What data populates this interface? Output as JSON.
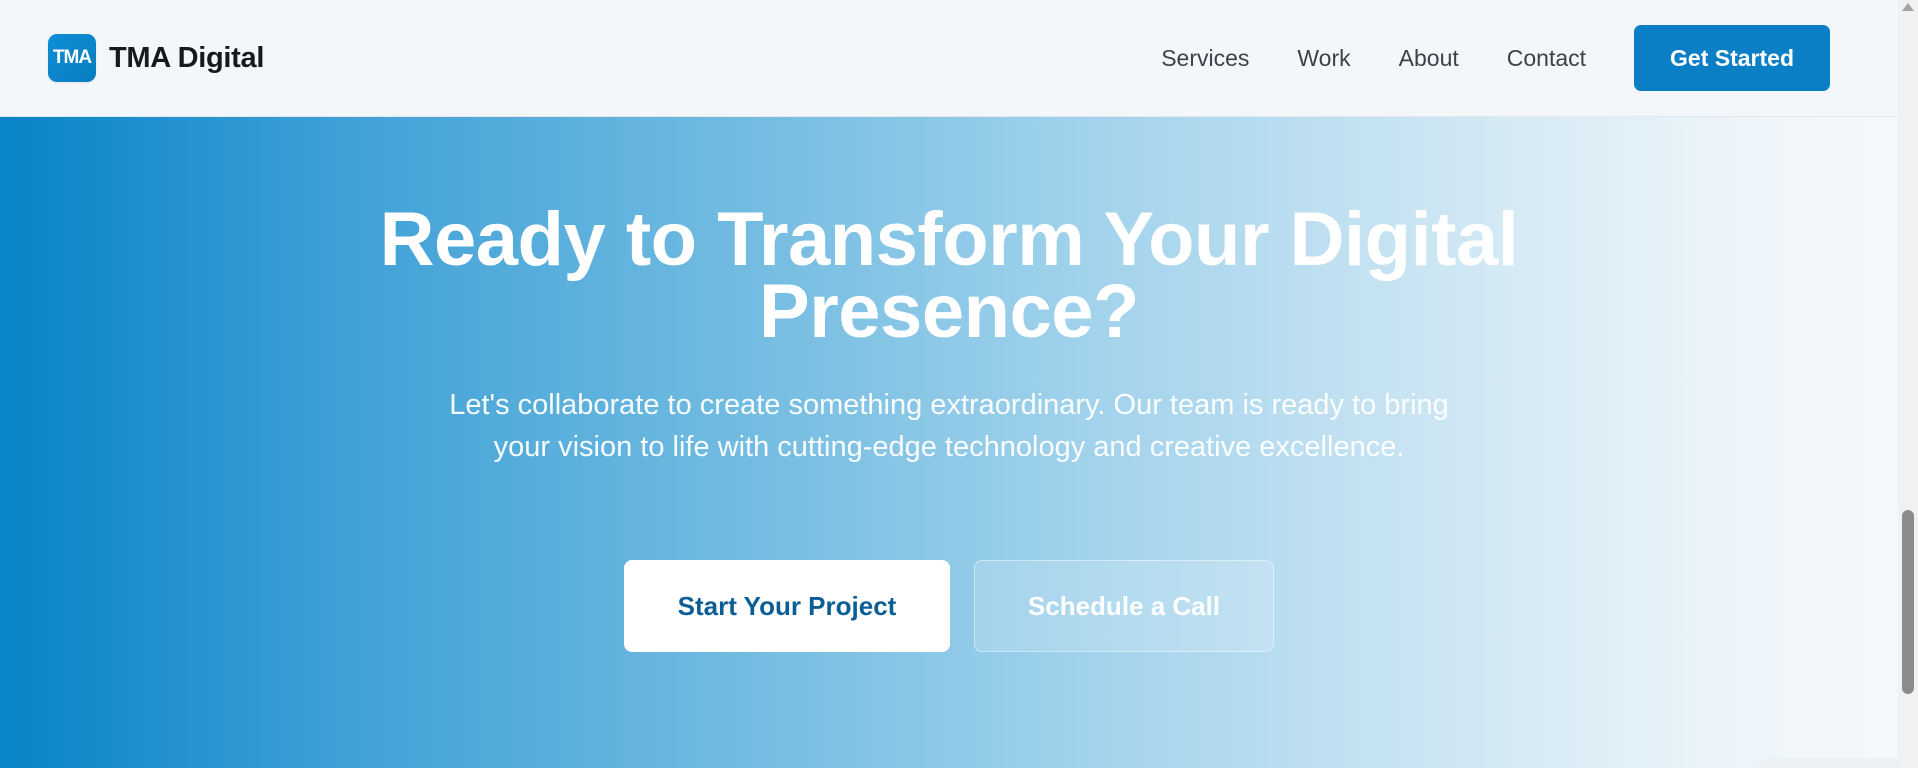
{
  "header": {
    "logo_text": "TMA",
    "brand_name": "TMA Digital",
    "nav": [
      {
        "label": "Services"
      },
      {
        "label": "Work"
      },
      {
        "label": "About"
      },
      {
        "label": "Contact"
      }
    ],
    "cta_label": "Get Started"
  },
  "hero": {
    "title_line1": "Ready to Transform Your Digital",
    "title_line2": "Presence?",
    "subtitle": "Let's collaborate to create something extraordinary. Our team is ready to bring your vision to life with cutting-edge technology and creative excellence.",
    "primary_button": "Start Your Project",
    "secondary_button": "Schedule a Call"
  },
  "colors": {
    "brand_blue": "#0a7fc6",
    "primary_button_text": "#0b5e93",
    "gradient_start": "#0884c8",
    "gradient_end": "#f4f8fb"
  }
}
